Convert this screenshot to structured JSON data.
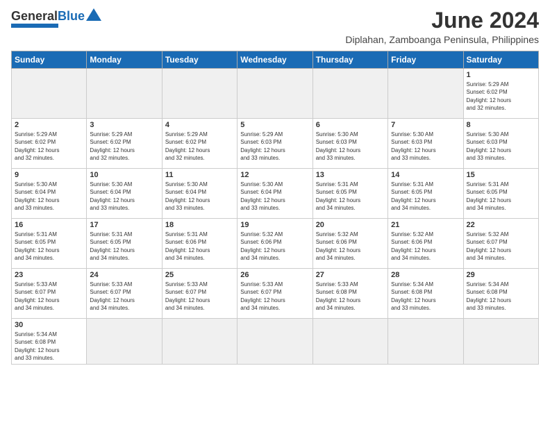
{
  "header": {
    "logo_general": "General",
    "logo_blue": "Blue",
    "month_year": "June 2024",
    "location": "Diplahan, Zamboanga Peninsula, Philippines"
  },
  "weekdays": [
    "Sunday",
    "Monday",
    "Tuesday",
    "Wednesday",
    "Thursday",
    "Friday",
    "Saturday"
  ],
  "weeks": [
    [
      {
        "day": "",
        "info": ""
      },
      {
        "day": "",
        "info": ""
      },
      {
        "day": "",
        "info": ""
      },
      {
        "day": "",
        "info": ""
      },
      {
        "day": "",
        "info": ""
      },
      {
        "day": "",
        "info": ""
      },
      {
        "day": "1",
        "info": "Sunrise: 5:29 AM\nSunset: 6:02 PM\nDaylight: 12 hours\nand 32 minutes."
      }
    ],
    [
      {
        "day": "2",
        "info": "Sunrise: 5:29 AM\nSunset: 6:02 PM\nDaylight: 12 hours\nand 32 minutes."
      },
      {
        "day": "3",
        "info": "Sunrise: 5:29 AM\nSunset: 6:02 PM\nDaylight: 12 hours\nand 32 minutes."
      },
      {
        "day": "4",
        "info": "Sunrise: 5:29 AM\nSunset: 6:02 PM\nDaylight: 12 hours\nand 32 minutes."
      },
      {
        "day": "5",
        "info": "Sunrise: 5:29 AM\nSunset: 6:03 PM\nDaylight: 12 hours\nand 33 minutes."
      },
      {
        "day": "6",
        "info": "Sunrise: 5:30 AM\nSunset: 6:03 PM\nDaylight: 12 hours\nand 33 minutes."
      },
      {
        "day": "7",
        "info": "Sunrise: 5:30 AM\nSunset: 6:03 PM\nDaylight: 12 hours\nand 33 minutes."
      },
      {
        "day": "8",
        "info": "Sunrise: 5:30 AM\nSunset: 6:03 PM\nDaylight: 12 hours\nand 33 minutes."
      }
    ],
    [
      {
        "day": "9",
        "info": "Sunrise: 5:30 AM\nSunset: 6:04 PM\nDaylight: 12 hours\nand 33 minutes."
      },
      {
        "day": "10",
        "info": "Sunrise: 5:30 AM\nSunset: 6:04 PM\nDaylight: 12 hours\nand 33 minutes."
      },
      {
        "day": "11",
        "info": "Sunrise: 5:30 AM\nSunset: 6:04 PM\nDaylight: 12 hours\nand 33 minutes."
      },
      {
        "day": "12",
        "info": "Sunrise: 5:30 AM\nSunset: 6:04 PM\nDaylight: 12 hours\nand 33 minutes."
      },
      {
        "day": "13",
        "info": "Sunrise: 5:31 AM\nSunset: 6:05 PM\nDaylight: 12 hours\nand 34 minutes."
      },
      {
        "day": "14",
        "info": "Sunrise: 5:31 AM\nSunset: 6:05 PM\nDaylight: 12 hours\nand 34 minutes."
      },
      {
        "day": "15",
        "info": "Sunrise: 5:31 AM\nSunset: 6:05 PM\nDaylight: 12 hours\nand 34 minutes."
      }
    ],
    [
      {
        "day": "16",
        "info": "Sunrise: 5:31 AM\nSunset: 6:05 PM\nDaylight: 12 hours\nand 34 minutes."
      },
      {
        "day": "17",
        "info": "Sunrise: 5:31 AM\nSunset: 6:05 PM\nDaylight: 12 hours\nand 34 minutes."
      },
      {
        "day": "18",
        "info": "Sunrise: 5:31 AM\nSunset: 6:06 PM\nDaylight: 12 hours\nand 34 minutes."
      },
      {
        "day": "19",
        "info": "Sunrise: 5:32 AM\nSunset: 6:06 PM\nDaylight: 12 hours\nand 34 minutes."
      },
      {
        "day": "20",
        "info": "Sunrise: 5:32 AM\nSunset: 6:06 PM\nDaylight: 12 hours\nand 34 minutes."
      },
      {
        "day": "21",
        "info": "Sunrise: 5:32 AM\nSunset: 6:06 PM\nDaylight: 12 hours\nand 34 minutes."
      },
      {
        "day": "22",
        "info": "Sunrise: 5:32 AM\nSunset: 6:07 PM\nDaylight: 12 hours\nand 34 minutes."
      }
    ],
    [
      {
        "day": "23",
        "info": "Sunrise: 5:33 AM\nSunset: 6:07 PM\nDaylight: 12 hours\nand 34 minutes."
      },
      {
        "day": "24",
        "info": "Sunrise: 5:33 AM\nSunset: 6:07 PM\nDaylight: 12 hours\nand 34 minutes."
      },
      {
        "day": "25",
        "info": "Sunrise: 5:33 AM\nSunset: 6:07 PM\nDaylight: 12 hours\nand 34 minutes."
      },
      {
        "day": "26",
        "info": "Sunrise: 5:33 AM\nSunset: 6:07 PM\nDaylight: 12 hours\nand 34 minutes."
      },
      {
        "day": "27",
        "info": "Sunrise: 5:33 AM\nSunset: 6:08 PM\nDaylight: 12 hours\nand 34 minutes."
      },
      {
        "day": "28",
        "info": "Sunrise: 5:34 AM\nSunset: 6:08 PM\nDaylight: 12 hours\nand 33 minutes."
      },
      {
        "day": "29",
        "info": "Sunrise: 5:34 AM\nSunset: 6:08 PM\nDaylight: 12 hours\nand 33 minutes."
      }
    ],
    [
      {
        "day": "30",
        "info": "Sunrise: 5:34 AM\nSunset: 6:08 PM\nDaylight: 12 hours\nand 33 minutes."
      },
      {
        "day": "",
        "info": ""
      },
      {
        "day": "",
        "info": ""
      },
      {
        "day": "",
        "info": ""
      },
      {
        "day": "",
        "info": ""
      },
      {
        "day": "",
        "info": ""
      },
      {
        "day": "",
        "info": ""
      }
    ]
  ]
}
